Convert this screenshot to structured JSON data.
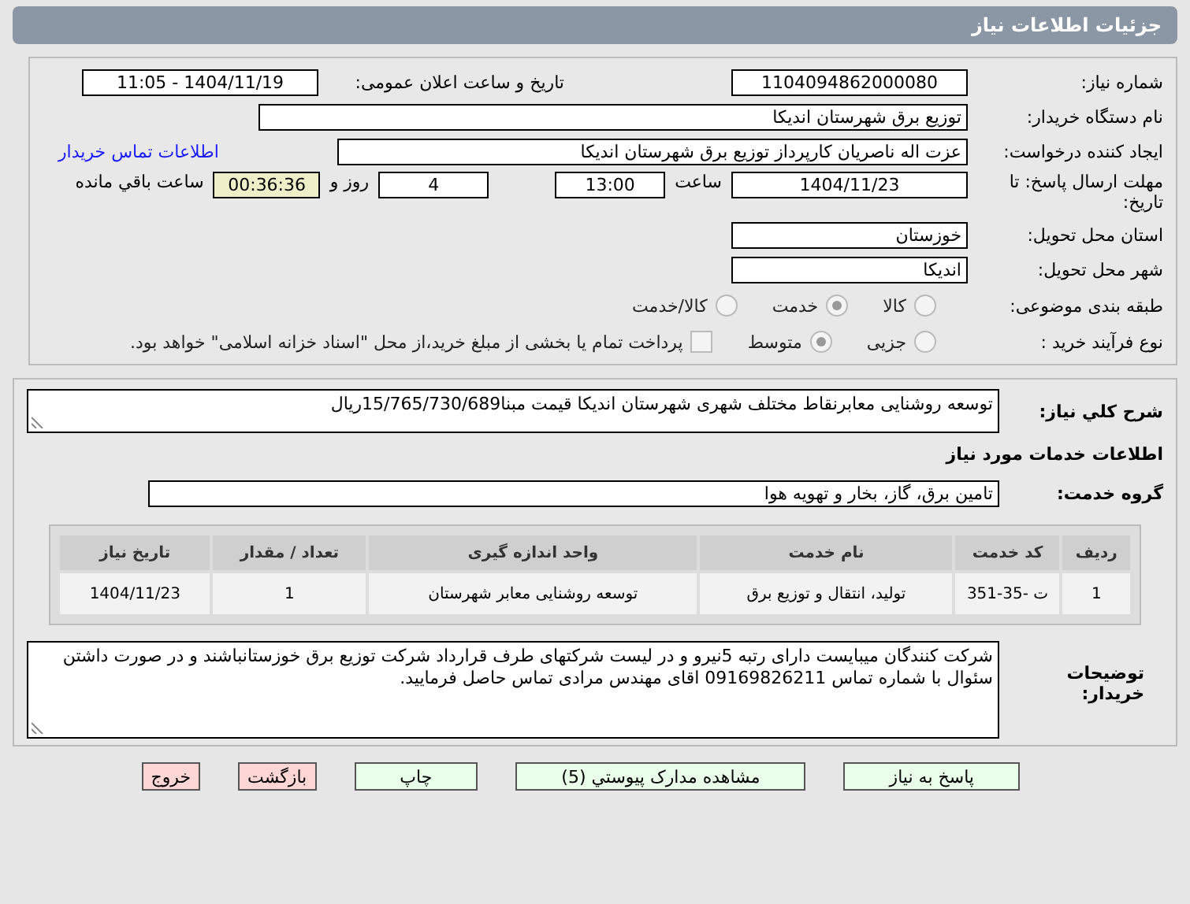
{
  "header": {
    "title": "جزئیات اطلاعات نیاز"
  },
  "details": {
    "need_number": {
      "label": "شماره نیاز:",
      "value": "1104094862000080"
    },
    "announce": {
      "label": "تاریخ و ساعت اعلان عمومی:",
      "value": "1404/11/19 - 11:05"
    },
    "buyer": {
      "label": "نام دستگاه خریدار:",
      "value": "توزیع برق شهرستان اندیکا"
    },
    "requester": {
      "label": "ایجاد کننده درخواست:",
      "value": "عزت اله ناصریان کارپرداز توزیع برق شهرستان اندیکا",
      "link": "اطلاعات تماس خریدار"
    },
    "deadline": {
      "label": "مهلت ارسال پاسخ: تا تاریخ:",
      "date": "1404/11/23",
      "time_label": "ساعت",
      "time": "13:00",
      "days": "4",
      "days_label": "روز و",
      "remaining": "00:36:36",
      "remaining_label": "ساعت باقي مانده"
    },
    "province": {
      "label": "استان محل تحویل:",
      "value": "خوزستان"
    },
    "city": {
      "label": "شهر محل تحویل:",
      "value": "اندیکا"
    },
    "category": {
      "label": "طبقه بندی موضوعی:",
      "options": [
        {
          "label": "کالا",
          "selected": false
        },
        {
          "label": "خدمت",
          "selected": true
        },
        {
          "label": "کالا/خدمت",
          "selected": false
        }
      ]
    },
    "purchase_type": {
      "label": "نوع فرآیند خرید :",
      "options": [
        {
          "label": "جزیی",
          "selected": false
        },
        {
          "label": "متوسط",
          "selected": true
        }
      ],
      "payment": {
        "checked": false,
        "text": "پرداخت تمام یا بخشی از مبلغ خرید،از محل \"اسناد خزانه اسلامی\" خواهد بود."
      }
    }
  },
  "description": {
    "label": "شرح كلي نیاز:",
    "value": "توسعه روشنایی معابرنقاط مختلف شهری شهرستان اندیکا قیمت مبنا15/765/730/689ریال"
  },
  "services": {
    "heading": "اطلاعات خدمات مورد نیاز",
    "group": {
      "label": "گروه خدمت:",
      "value": "تامین برق، گاز، بخار و تهویه هوا"
    },
    "table": {
      "columns": [
        "ردیف",
        "کد خدمت",
        "نام خدمت",
        "واحد اندازه گیری",
        "تعداد / مقدار",
        "تاریخ نیاز"
      ],
      "rows": [
        [
          "1",
          "ت -35-351",
          "تولید، انتقال و توزیع برق",
          "توسعه روشنایی معابر شهرستان",
          "1",
          "1404/11/23"
        ]
      ]
    }
  },
  "notes": {
    "label": "توضیحات خریدار:",
    "value": "شرکت کنندگان میبایست دارای رتبه 5نیرو و در لیست شرکتهای طرف قرارداد شرکت توزیع برق خوزستانباشند و در صورت داشتن سئوال با شماره تماس 09169826211 اقای مهندس مرادی تماس حاصل فرمایید."
  },
  "buttons": [
    {
      "label": "پاسخ به نیاز",
      "kind": "go"
    },
    {
      "label": "مشاهده مدارک پیوستي (5)",
      "kind": "go"
    },
    {
      "label": "چاپ",
      "kind": "go"
    },
    {
      "label": "بازگشت",
      "kind": "stop"
    },
    {
      "label": "خروج",
      "kind": "stop"
    }
  ]
}
